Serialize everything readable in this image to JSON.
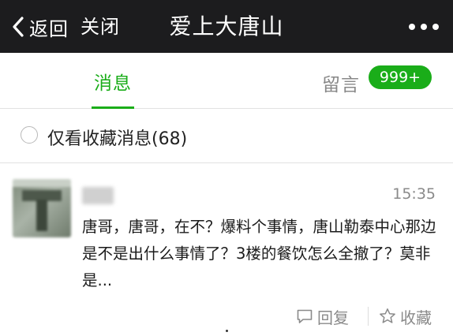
{
  "navbar": {
    "back_label": "返回",
    "close_label": "关闭",
    "title": "爱上大唐山",
    "more_icon": "more-dots-icon"
  },
  "tabs": [
    {
      "label": "消息",
      "active": true
    },
    {
      "label": "留言",
      "active": false,
      "badge": "999+"
    }
  ],
  "filter": {
    "label": "仅看收藏消息(68)",
    "checked": false
  },
  "message": {
    "time": "15:35",
    "body": "唐哥，唐哥，在不？爆料个事情，唐山勒泰中心那边是不是出什么事情了？3楼的餐饮怎么全撤了？莫非是...",
    "actions": {
      "reply_label": "回复",
      "favorite_label": "收藏"
    }
  },
  "colors": {
    "accent_green": "#1aad19",
    "navbar_bg": "#1c1c1e",
    "muted_text": "#8a8a8a"
  }
}
